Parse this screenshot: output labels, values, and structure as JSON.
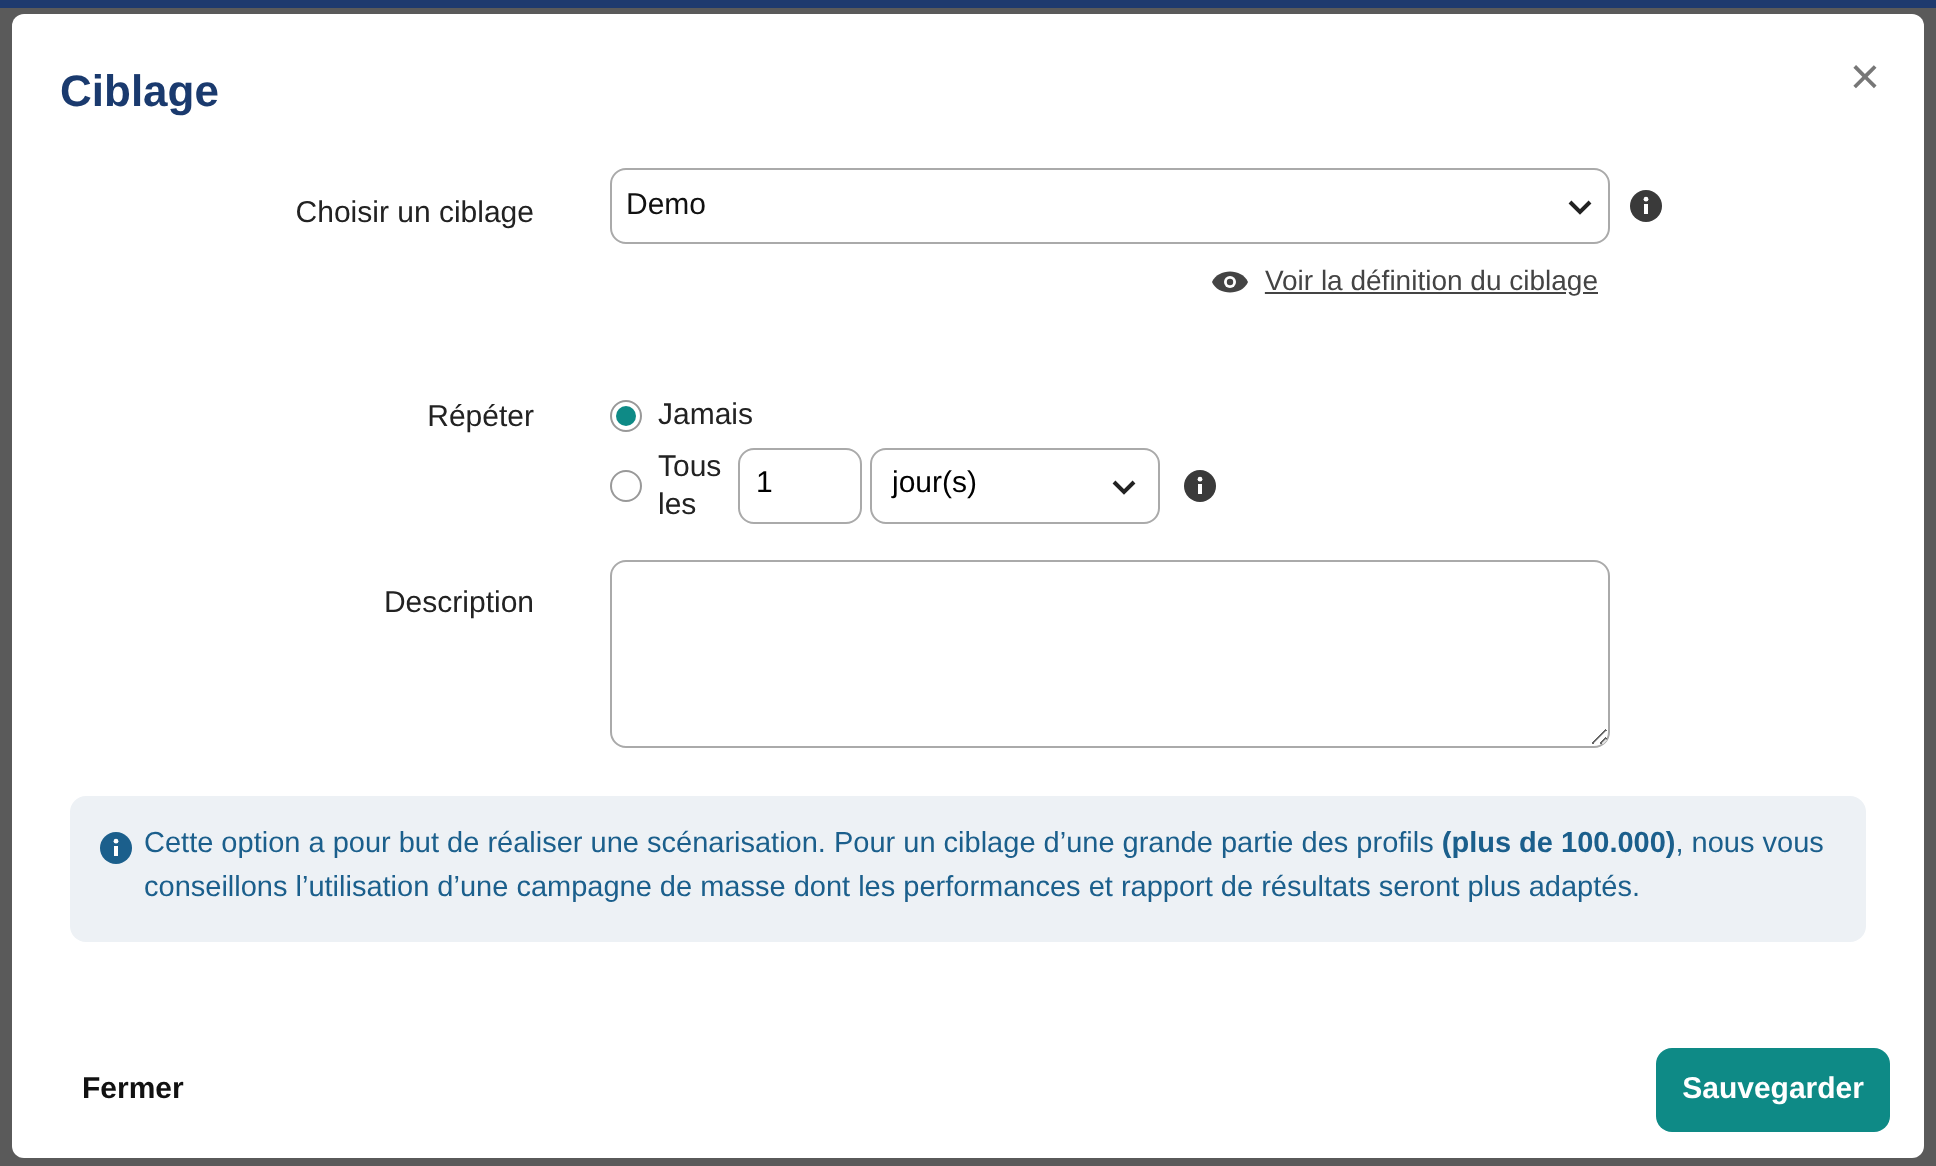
{
  "dialog": {
    "title": "Ciblage",
    "close": "×"
  },
  "targeting": {
    "label": "Choisir un ciblage",
    "value": "Demo",
    "link": "Voir la définition du ciblage"
  },
  "repeat": {
    "label": "Répéter",
    "options": [
      {
        "kind": "plain",
        "label": "Jamais",
        "selected": true
      },
      {
        "kind": "interval",
        "label": "Tous les",
        "count": "1",
        "unit": "jour(s)",
        "selected": false
      }
    ]
  },
  "description": {
    "label": "Description"
  },
  "notice": "Cette option a pour but de réaliser une scénarisation. Pour un ciblage d’une grande partie des profils **(plus de 100.000)**, nous vous conseillons l’utilisation d’une campagne de masse dont les performances et rapport de résultats seront plus adaptés.",
  "buttons": {
    "close": "Fermer",
    "save": "Sauvegarder"
  }
}
